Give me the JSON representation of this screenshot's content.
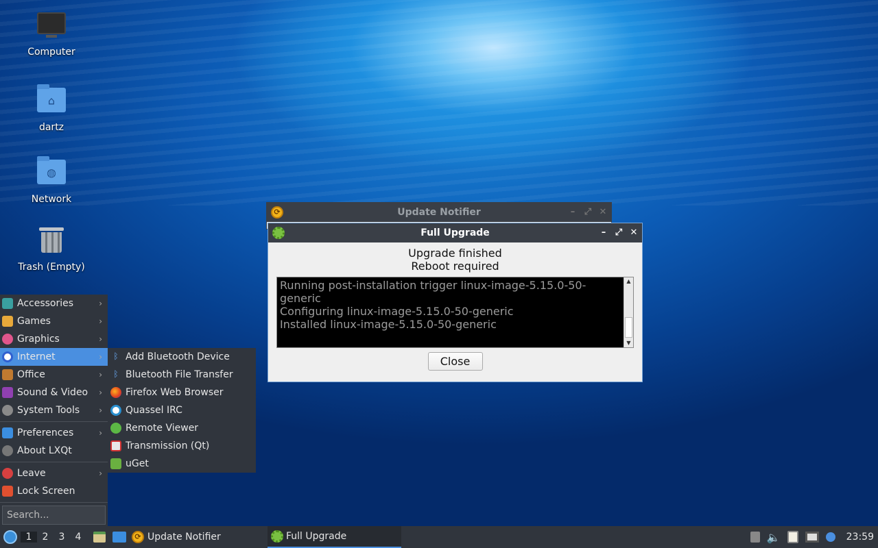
{
  "desktop": {
    "icons": [
      {
        "label": "Computer"
      },
      {
        "label": "dartz"
      },
      {
        "label": "Network"
      },
      {
        "label": "Trash (Empty)"
      }
    ]
  },
  "update_notifier": {
    "title": "Update Notifier"
  },
  "full_upgrade": {
    "title": "Full Upgrade",
    "status_line1": "Upgrade finished",
    "status_line2": "Reboot required",
    "log_lines": [
      "Running post-installation trigger linux-image-5.15.0-50-",
      "generic",
      "Configuring linux-image-5.15.0-50-generic",
      "Installed linux-image-5.15.0-50-generic"
    ],
    "close_label": "Close"
  },
  "menu": {
    "categories": [
      {
        "label": "Accessories",
        "icon": "accessories-icon",
        "color": "#3aa0a0"
      },
      {
        "label": "Games",
        "icon": "games-icon",
        "color": "#e8a93a"
      },
      {
        "label": "Graphics",
        "icon": "graphics-icon",
        "color": "#e0568c"
      },
      {
        "label": "Internet",
        "icon": "internet-icon",
        "color": "#3060d0"
      },
      {
        "label": "Office",
        "icon": "office-icon",
        "color": "#c07a30"
      },
      {
        "label": "Sound & Video",
        "icon": "sound-video-icon",
        "color": "#9040b0"
      },
      {
        "label": "System Tools",
        "icon": "system-tools-icon",
        "color": "#8a8a8a"
      }
    ],
    "prefs": [
      {
        "label": "Preferences",
        "icon": "preferences-icon",
        "color": "#3b8ee0"
      },
      {
        "label": "About LXQt",
        "icon": "about-icon",
        "color": "#777777"
      }
    ],
    "session": [
      {
        "label": "Leave",
        "icon": "leave-icon",
        "color": "#d64040"
      },
      {
        "label": "Lock Screen",
        "icon": "lock-icon",
        "color": "#e05030"
      }
    ],
    "search_placeholder": "Search...",
    "internet_submenu": [
      {
        "label": "Add Bluetooth Device",
        "icon": "bluetooth-icon"
      },
      {
        "label": "Bluetooth File Transfer",
        "icon": "bluetooth-icon"
      },
      {
        "label": "Firefox Web Browser",
        "icon": "firefox-icon"
      },
      {
        "label": "Quassel IRC",
        "icon": "quassel-icon"
      },
      {
        "label": "Remote Viewer",
        "icon": "remote-viewer-icon"
      },
      {
        "label": "Transmission (Qt)",
        "icon": "transmission-icon"
      },
      {
        "label": "uGet",
        "icon": "uget-icon"
      }
    ]
  },
  "taskbar": {
    "workspaces": [
      "1",
      "2",
      "3",
      "4"
    ],
    "tasks": [
      {
        "label": "Update Notifier"
      },
      {
        "label": "Full Upgrade"
      }
    ],
    "clock": "23:59"
  }
}
